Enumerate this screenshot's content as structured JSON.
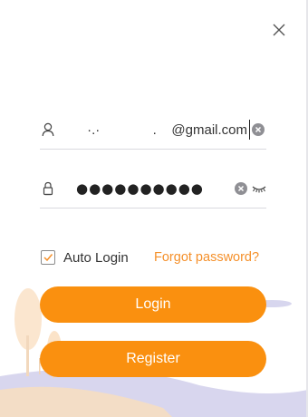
{
  "window": {
    "close_icon": "close-icon"
  },
  "username": {
    "icon": "user-icon",
    "value": "·.·              .    @gmail.com",
    "clear_icon": "clear-icon"
  },
  "password": {
    "icon": "lock-icon",
    "masked_value": "●●●●●●●●●●",
    "clear_icon": "clear-icon",
    "visibility_icon": "eye-closed-icon"
  },
  "auto_login": {
    "label": "Auto Login",
    "checked": true
  },
  "forgot_password": {
    "label": "Forgot password?"
  },
  "buttons": {
    "login_label": "Login",
    "register_label": "Register"
  },
  "colors": {
    "accent": "#fa900f",
    "link": "#f5902a",
    "text": "#333333",
    "decor_lavender": "#c9c6e6",
    "decor_peach": "#f6dcc0"
  }
}
